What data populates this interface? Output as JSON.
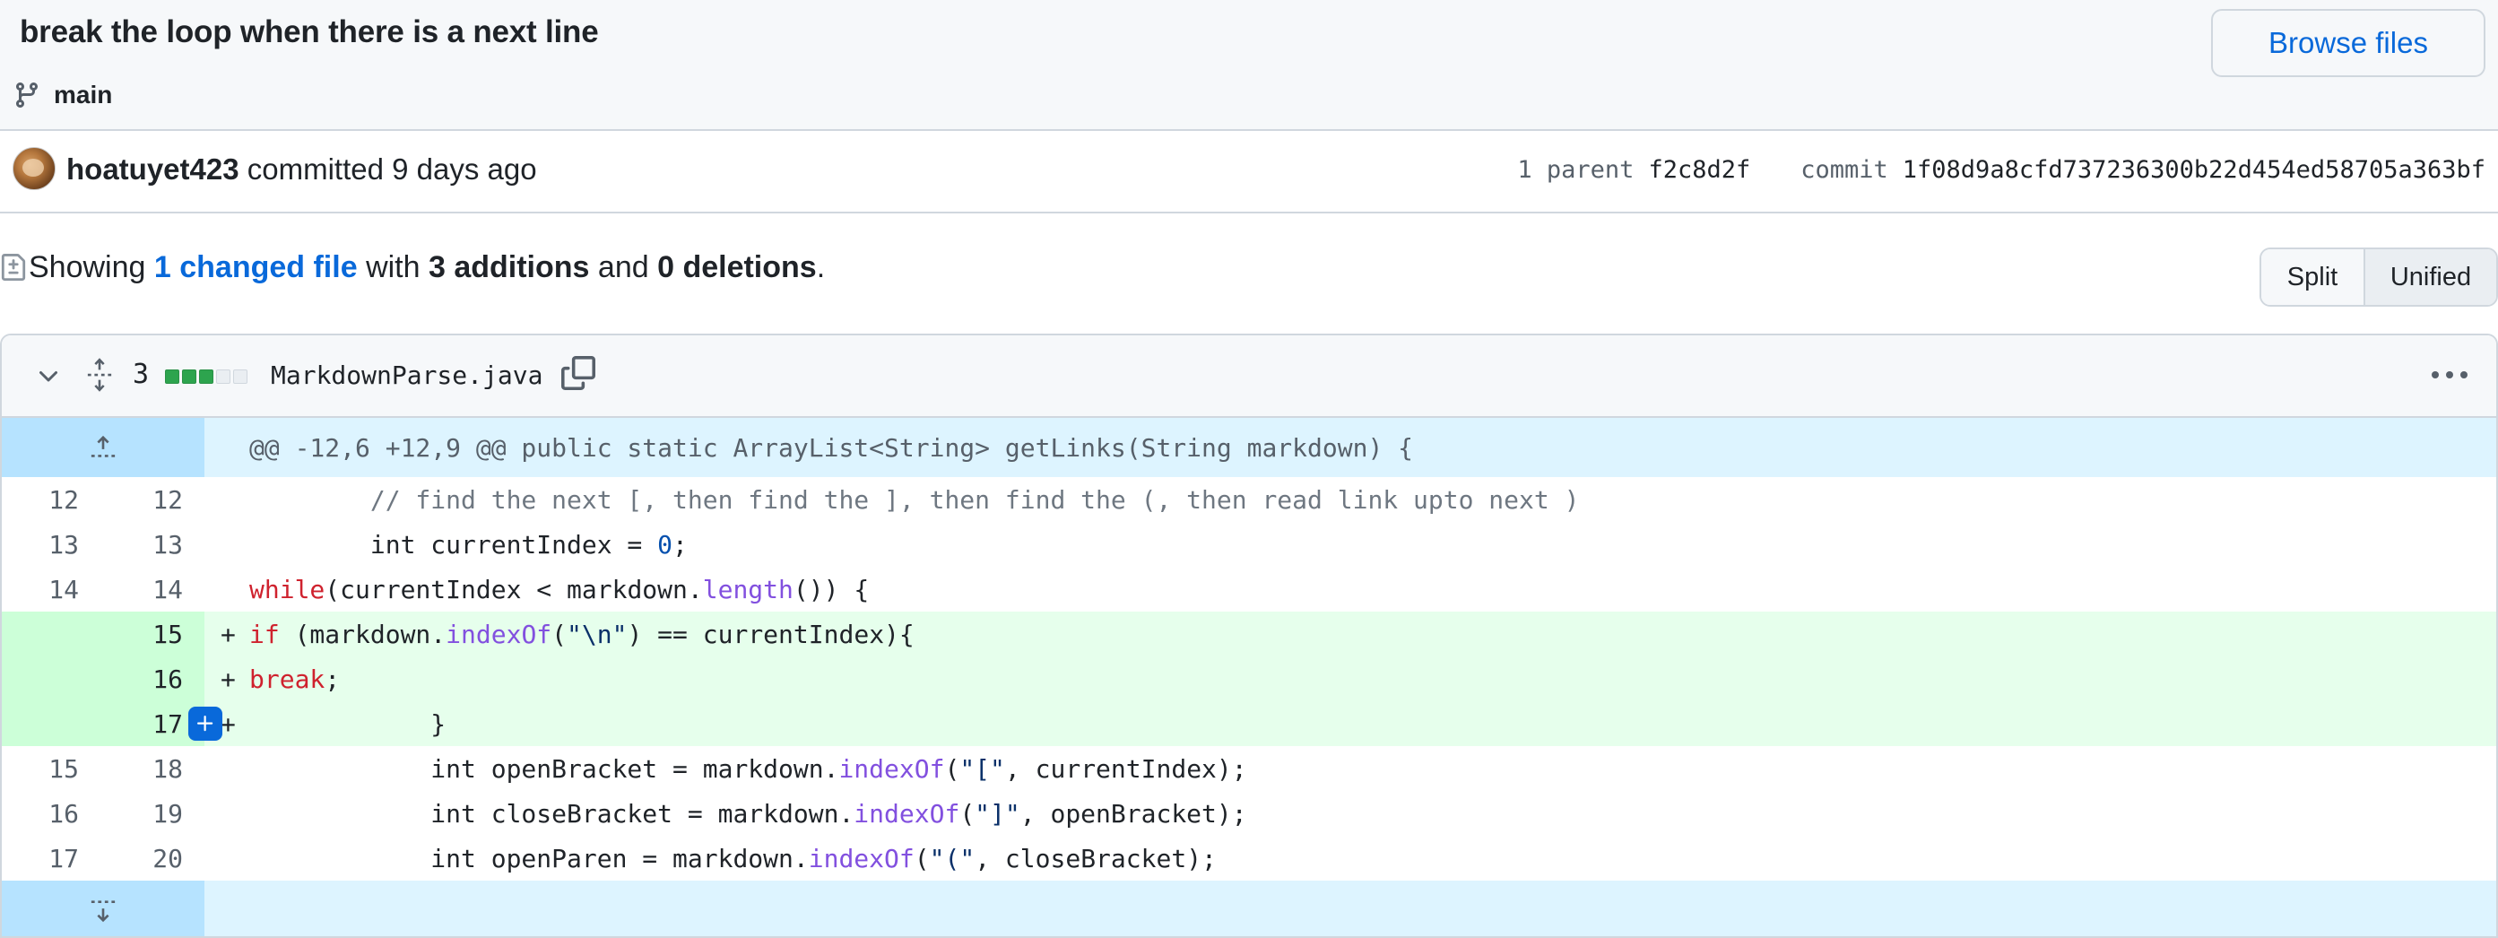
{
  "commit": {
    "title": "break the loop when there is a next line",
    "branch": "main",
    "browse_files_label": "Browse files",
    "author": "hoatuyet423",
    "action": "committed",
    "time": "9 days ago",
    "parent_label": "1 parent",
    "parent_sha": "f2c8d2f",
    "commit_label": "commit",
    "commit_sha": "1f08d9a8cfd737236300b22d454ed58705a363bf"
  },
  "summary": {
    "showing": "Showing",
    "changed_files": "1 changed file",
    "with": "with",
    "additions": "3 additions",
    "and": "and",
    "deletions": "0 deletions",
    "period": "."
  },
  "view_toggle": {
    "split": "Split",
    "unified": "Unified",
    "selected": "Unified"
  },
  "file": {
    "change_count": "3",
    "diffstat": [
      "add",
      "add",
      "add",
      "neutral",
      "neutral"
    ],
    "name": "MarkdownParse.java"
  },
  "diff": {
    "hunk_header": "@@ -12,6 +12,9 @@ public static ArrayList<String> getLinks(String markdown) {",
    "lines": [
      {
        "old": "12",
        "new": "12",
        "type": "context",
        "mark": "",
        "code": "        // find the next [, then find the ], then find the (, then read link upto next )"
      },
      {
        "old": "13",
        "new": "13",
        "type": "context",
        "mark": "",
        "code": "        int currentIndex = 0;"
      },
      {
        "old": "14",
        "new": "14",
        "type": "context",
        "mark": "",
        "code": "        while(currentIndex < markdown.length()) {"
      },
      {
        "old": "",
        "new": "15",
        "type": "add",
        "mark": "+",
        "code": "            if (markdown.indexOf(\"\\n\") == currentIndex){"
      },
      {
        "old": "",
        "new": "16",
        "type": "add",
        "mark": "+",
        "code": "                break;"
      },
      {
        "old": "",
        "new": "17",
        "type": "add",
        "mark": "+",
        "code": "            }"
      },
      {
        "old": "15",
        "new": "18",
        "type": "context",
        "mark": "",
        "code": "            int openBracket = markdown.indexOf(\"[\", currentIndex);"
      },
      {
        "old": "16",
        "new": "19",
        "type": "context",
        "mark": "",
        "code": "            int closeBracket = markdown.indexOf(\"]\", openBracket);"
      },
      {
        "old": "17",
        "new": "20",
        "type": "context",
        "mark": "",
        "code": "            int openParen = markdown.indexOf(\"(\", closeBracket);"
      }
    ]
  },
  "icons": {
    "branch": "git-branch-icon",
    "expand_file": "unfold-icon",
    "collapse": "chevron-down-icon",
    "copy": "copy-icon",
    "more": "kebab-horizontal-icon",
    "expand_up": "expand-up-icon",
    "expand_down": "expand-down-icon",
    "add_comment": "plus-icon"
  },
  "colors": {
    "link": "#0969da",
    "addition_bg": "#e6ffec",
    "addition_gutter": "#ccffd8",
    "hunk_bg": "#ddf4ff",
    "keyword": "#cf222e",
    "method": "#8250df"
  }
}
